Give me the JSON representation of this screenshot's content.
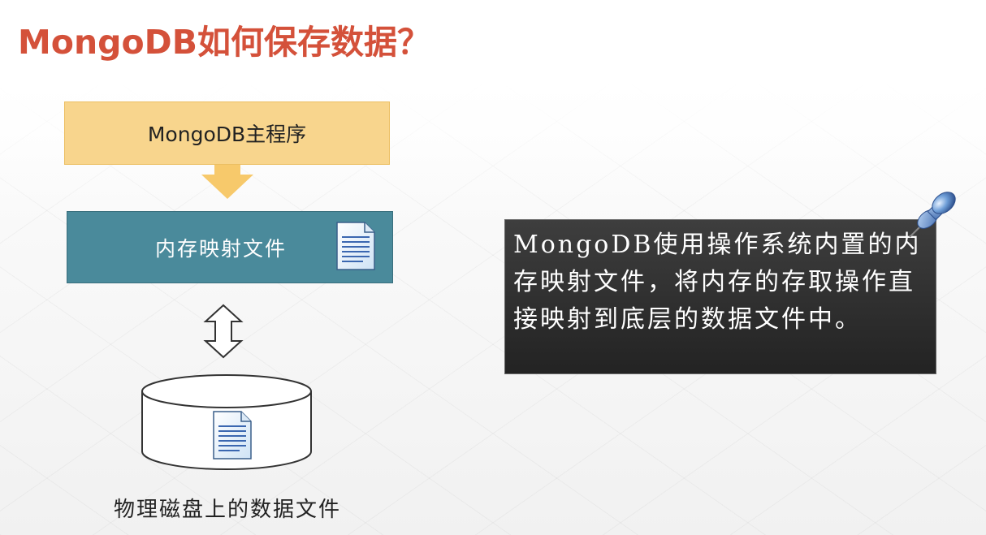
{
  "title": "MongoDB如何保存数据？",
  "diagram": {
    "main_program_label": "MongoDB主程序",
    "memory_mapped_label": "内存映射文件",
    "disk_label": "物理磁盘上的数据文件",
    "colors": {
      "title": "#d4513a",
      "main_box": "#f8d58d",
      "arrow": "#f7c96b",
      "mmap_box": "#4a8a9b",
      "note_bg": "#2d2d2d"
    },
    "icons": [
      "document-icon",
      "up-down-arrow-icon",
      "disk-cylinder-icon",
      "pushpin-icon"
    ]
  },
  "note": {
    "text": "MongoDB使用操作系统内置的内存映射文件，将内存的存取操作直接映射到底层的数据文件中。"
  }
}
